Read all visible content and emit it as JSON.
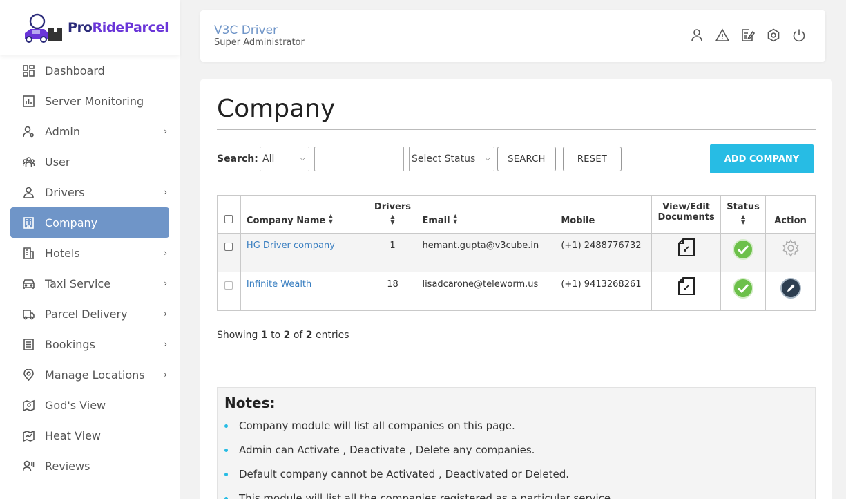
{
  "brand": {
    "name_part1": "Pro",
    "name_part2": "RideParcel"
  },
  "sidebar": {
    "items": [
      {
        "label": "Dashboard",
        "icon": "dashboard-icon",
        "has_submenu": false
      },
      {
        "label": "Server Monitoring",
        "icon": "chart-icon",
        "has_submenu": false
      },
      {
        "label": "Admin",
        "icon": "admin-icon",
        "has_submenu": true
      },
      {
        "label": "User",
        "icon": "users-icon",
        "has_submenu": false
      },
      {
        "label": "Drivers",
        "icon": "driver-icon",
        "has_submenu": true
      },
      {
        "label": "Company",
        "icon": "building-icon",
        "has_submenu": false,
        "active": true
      },
      {
        "label": "Hotels",
        "icon": "hotel-icon",
        "has_submenu": true
      },
      {
        "label": "Taxi Service",
        "icon": "car-icon",
        "has_submenu": true
      },
      {
        "label": "Parcel Delivery",
        "icon": "truck-icon",
        "has_submenu": true
      },
      {
        "label": "Bookings",
        "icon": "bookings-icon",
        "has_submenu": true
      },
      {
        "label": "Manage Locations",
        "icon": "location-pin-icon",
        "has_submenu": true
      },
      {
        "label": "God's View",
        "icon": "map-icon",
        "has_submenu": false
      },
      {
        "label": "Heat View",
        "icon": "heatmap-icon",
        "has_submenu": false
      },
      {
        "label": "Reviews",
        "icon": "review-icon",
        "has_submenu": false
      }
    ]
  },
  "header": {
    "title": "V3C Driver",
    "subtitle": "Super Administrator",
    "icons": [
      "profile-icon",
      "alert-icon",
      "edit-note-icon",
      "settings-icon",
      "power-icon"
    ]
  },
  "main": {
    "title": "Company",
    "search": {
      "label": "Search:",
      "filter_value": "All",
      "query_value": "",
      "status_value": "Select Status",
      "search_button": "SEARCH",
      "reset_button": "RESET",
      "add_button": "ADD COMPANY"
    },
    "table": {
      "headers": {
        "company": "Company Name",
        "drivers": "Drivers",
        "email": "Email",
        "mobile": "Mobile",
        "docs_line1": "View/Edit",
        "docs_line2": "Documents",
        "status": "Status",
        "action": "Action"
      },
      "rows": [
        {
          "company": "HG Driver company",
          "drivers": "1",
          "email": "hemant.gupta@v3cube.in",
          "mobile": "(+1) 2488776732",
          "status": "active",
          "action": "settings"
        },
        {
          "company": "Infinite Wealth",
          "drivers": "18",
          "email": "lisadcarone@teleworm.us",
          "mobile": "(+1) 9413268261",
          "status": "active",
          "action": "edit"
        }
      ]
    },
    "showing": {
      "prefix": "Showing",
      "from": "1",
      "to_word": "to",
      "to": "2",
      "of_word": "of",
      "total": "2",
      "suffix": "entries"
    },
    "notes": {
      "title": "Notes:",
      "items": [
        "Company module will list all companies on this page.",
        "Admin can Activate , Deactivate , Delete any companies.",
        "Default company cannot be Activated , Deactivated or Deleted.",
        "This module will list all the companies registered as a particular service."
      ]
    }
  },
  "colors": {
    "accent": "#27bce4",
    "active_nav": "#6f95c8",
    "link": "#3a7fc1",
    "status_green": "#6cc04a",
    "action_dark": "#2d3e50"
  }
}
